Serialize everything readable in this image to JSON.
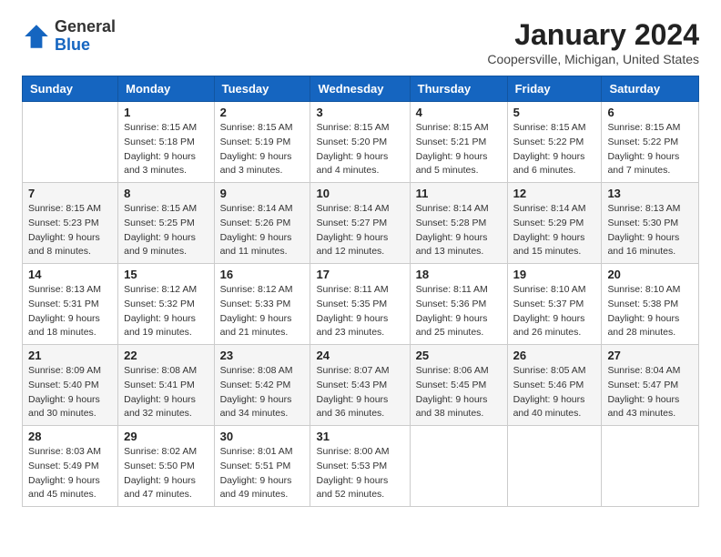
{
  "logo": {
    "general": "General",
    "blue": "Blue"
  },
  "header": {
    "title": "January 2024",
    "subtitle": "Coopersville, Michigan, United States"
  },
  "days_of_week": [
    "Sunday",
    "Monday",
    "Tuesday",
    "Wednesday",
    "Thursday",
    "Friday",
    "Saturday"
  ],
  "weeks": [
    [
      {
        "day": "",
        "detail": ""
      },
      {
        "day": "1",
        "detail": "Sunrise: 8:15 AM\nSunset: 5:18 PM\nDaylight: 9 hours\nand 3 minutes."
      },
      {
        "day": "2",
        "detail": "Sunrise: 8:15 AM\nSunset: 5:19 PM\nDaylight: 9 hours\nand 3 minutes."
      },
      {
        "day": "3",
        "detail": "Sunrise: 8:15 AM\nSunset: 5:20 PM\nDaylight: 9 hours\nand 4 minutes."
      },
      {
        "day": "4",
        "detail": "Sunrise: 8:15 AM\nSunset: 5:21 PM\nDaylight: 9 hours\nand 5 minutes."
      },
      {
        "day": "5",
        "detail": "Sunrise: 8:15 AM\nSunset: 5:22 PM\nDaylight: 9 hours\nand 6 minutes."
      },
      {
        "day": "6",
        "detail": "Sunrise: 8:15 AM\nSunset: 5:22 PM\nDaylight: 9 hours\nand 7 minutes."
      }
    ],
    [
      {
        "day": "7",
        "detail": "Sunrise: 8:15 AM\nSunset: 5:23 PM\nDaylight: 9 hours\nand 8 minutes."
      },
      {
        "day": "8",
        "detail": "Sunrise: 8:15 AM\nSunset: 5:25 PM\nDaylight: 9 hours\nand 9 minutes."
      },
      {
        "day": "9",
        "detail": "Sunrise: 8:14 AM\nSunset: 5:26 PM\nDaylight: 9 hours\nand 11 minutes."
      },
      {
        "day": "10",
        "detail": "Sunrise: 8:14 AM\nSunset: 5:27 PM\nDaylight: 9 hours\nand 12 minutes."
      },
      {
        "day": "11",
        "detail": "Sunrise: 8:14 AM\nSunset: 5:28 PM\nDaylight: 9 hours\nand 13 minutes."
      },
      {
        "day": "12",
        "detail": "Sunrise: 8:14 AM\nSunset: 5:29 PM\nDaylight: 9 hours\nand 15 minutes."
      },
      {
        "day": "13",
        "detail": "Sunrise: 8:13 AM\nSunset: 5:30 PM\nDaylight: 9 hours\nand 16 minutes."
      }
    ],
    [
      {
        "day": "14",
        "detail": "Sunrise: 8:13 AM\nSunset: 5:31 PM\nDaylight: 9 hours\nand 18 minutes."
      },
      {
        "day": "15",
        "detail": "Sunrise: 8:12 AM\nSunset: 5:32 PM\nDaylight: 9 hours\nand 19 minutes."
      },
      {
        "day": "16",
        "detail": "Sunrise: 8:12 AM\nSunset: 5:33 PM\nDaylight: 9 hours\nand 21 minutes."
      },
      {
        "day": "17",
        "detail": "Sunrise: 8:11 AM\nSunset: 5:35 PM\nDaylight: 9 hours\nand 23 minutes."
      },
      {
        "day": "18",
        "detail": "Sunrise: 8:11 AM\nSunset: 5:36 PM\nDaylight: 9 hours\nand 25 minutes."
      },
      {
        "day": "19",
        "detail": "Sunrise: 8:10 AM\nSunset: 5:37 PM\nDaylight: 9 hours\nand 26 minutes."
      },
      {
        "day": "20",
        "detail": "Sunrise: 8:10 AM\nSunset: 5:38 PM\nDaylight: 9 hours\nand 28 minutes."
      }
    ],
    [
      {
        "day": "21",
        "detail": "Sunrise: 8:09 AM\nSunset: 5:40 PM\nDaylight: 9 hours\nand 30 minutes."
      },
      {
        "day": "22",
        "detail": "Sunrise: 8:08 AM\nSunset: 5:41 PM\nDaylight: 9 hours\nand 32 minutes."
      },
      {
        "day": "23",
        "detail": "Sunrise: 8:08 AM\nSunset: 5:42 PM\nDaylight: 9 hours\nand 34 minutes."
      },
      {
        "day": "24",
        "detail": "Sunrise: 8:07 AM\nSunset: 5:43 PM\nDaylight: 9 hours\nand 36 minutes."
      },
      {
        "day": "25",
        "detail": "Sunrise: 8:06 AM\nSunset: 5:45 PM\nDaylight: 9 hours\nand 38 minutes."
      },
      {
        "day": "26",
        "detail": "Sunrise: 8:05 AM\nSunset: 5:46 PM\nDaylight: 9 hours\nand 40 minutes."
      },
      {
        "day": "27",
        "detail": "Sunrise: 8:04 AM\nSunset: 5:47 PM\nDaylight: 9 hours\nand 43 minutes."
      }
    ],
    [
      {
        "day": "28",
        "detail": "Sunrise: 8:03 AM\nSunset: 5:49 PM\nDaylight: 9 hours\nand 45 minutes."
      },
      {
        "day": "29",
        "detail": "Sunrise: 8:02 AM\nSunset: 5:50 PM\nDaylight: 9 hours\nand 47 minutes."
      },
      {
        "day": "30",
        "detail": "Sunrise: 8:01 AM\nSunset: 5:51 PM\nDaylight: 9 hours\nand 49 minutes."
      },
      {
        "day": "31",
        "detail": "Sunrise: 8:00 AM\nSunset: 5:53 PM\nDaylight: 9 hours\nand 52 minutes."
      },
      {
        "day": "",
        "detail": ""
      },
      {
        "day": "",
        "detail": ""
      },
      {
        "day": "",
        "detail": ""
      }
    ]
  ]
}
